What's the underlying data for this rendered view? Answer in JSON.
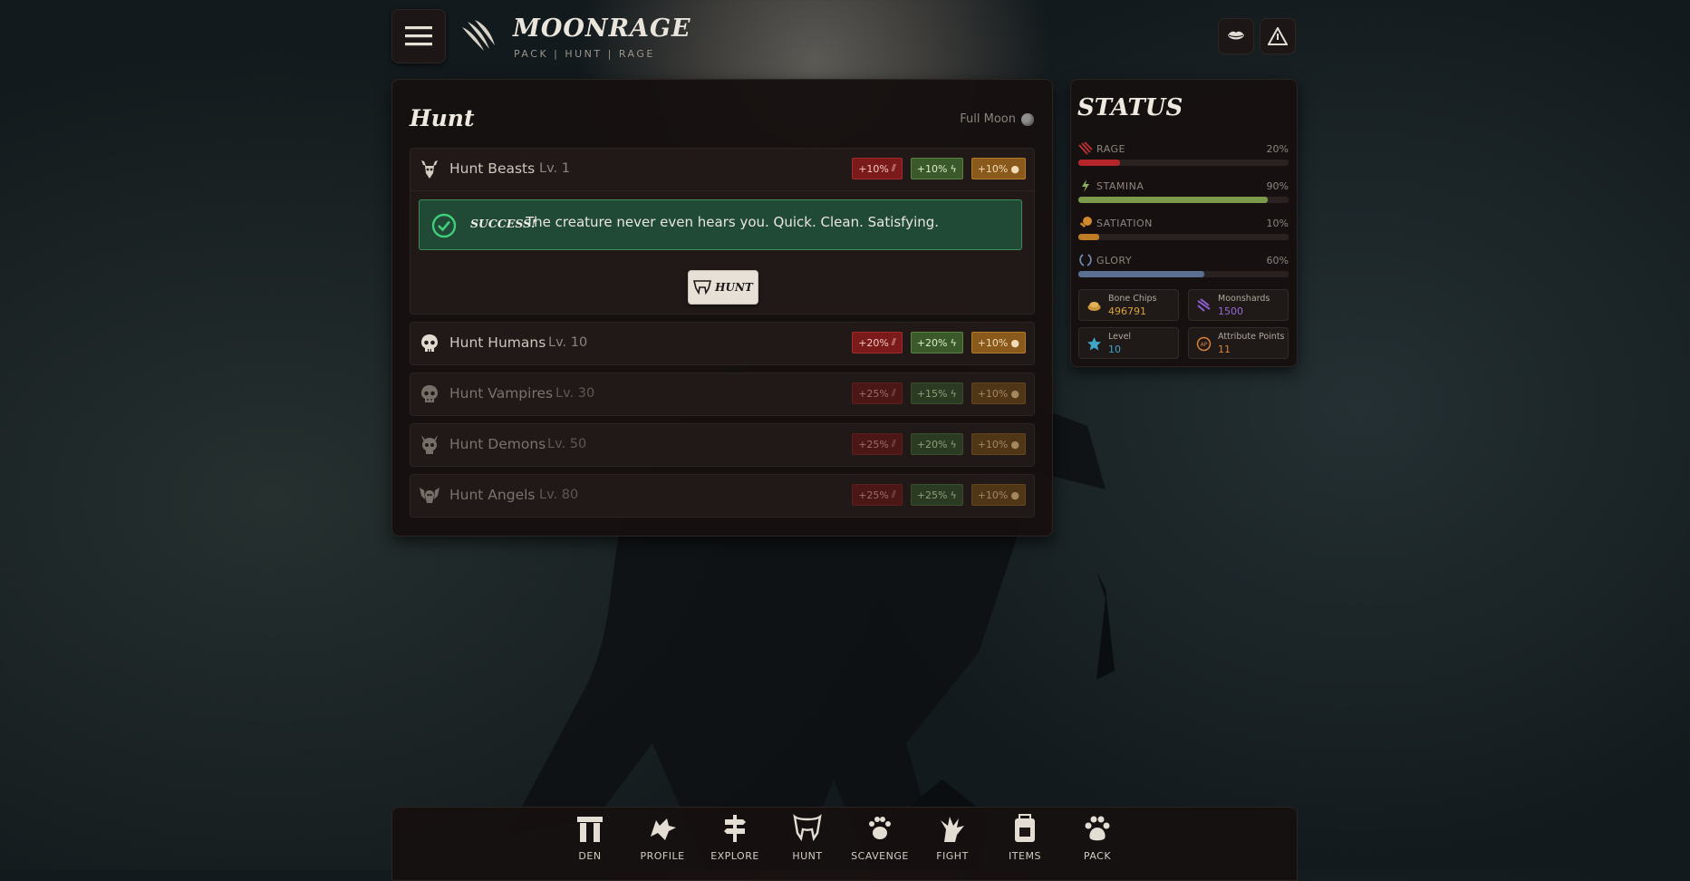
{
  "header": {
    "title": "MOONRAGE",
    "subtitle": "PACK | HUNT | RAGE"
  },
  "icons": {
    "menu": "hamburger-icon",
    "logo": "claw-marks-icon",
    "top_right": [
      "lips-icon",
      "warning-icon"
    ]
  },
  "hunt": {
    "title": "Hunt",
    "moon_phase": "Full Moon",
    "items": [
      {
        "name": "Hunt Beasts",
        "level": "Lv. 1",
        "icon": "stag-skull-icon",
        "rage": "+10%",
        "stamina": "+10%",
        "satiation": "+10%",
        "locked": false
      },
      {
        "name": "Hunt Humans",
        "level": "Lv. 10",
        "icon": "skull-icon",
        "rage": "+20%",
        "stamina": "+20%",
        "satiation": "+10%",
        "locked": false
      },
      {
        "name": "Hunt Vampires",
        "level": "Lv. 30",
        "icon": "vampire-skull-icon",
        "rage": "+25%",
        "stamina": "+15%",
        "satiation": "+10%",
        "locked": true
      },
      {
        "name": "Hunt Demons",
        "level": "Lv. 50",
        "icon": "demon-skull-icon",
        "rage": "+25%",
        "stamina": "+20%",
        "satiation": "+10%",
        "locked": true
      },
      {
        "name": "Hunt Angels",
        "level": "Lv. 80",
        "icon": "angel-wings-icon",
        "rage": "+25%",
        "stamina": "+25%",
        "satiation": "+10%",
        "locked": true
      }
    ],
    "result": {
      "title": "SUCCESS!",
      "message": "The creature never even hears you. Quick. Clean. Satisfying."
    },
    "action_label": "HUNT"
  },
  "status": {
    "title": "STATUS",
    "bars": [
      {
        "label": "RAGE",
        "value": 20,
        "display": "20%",
        "color": "#b5262a",
        "icon": "claw-slash-icon"
      },
      {
        "label": "STAMINA",
        "value": 90,
        "display": "90%",
        "color": "#7c9a4a",
        "icon": "lightning-icon"
      },
      {
        "label": "SATIATION",
        "value": 10,
        "display": "10%",
        "color": "#c07b25",
        "icon": "meat-icon"
      },
      {
        "label": "GLORY",
        "value": 60,
        "display": "60%",
        "color": "#5b6f91",
        "icon": "laurel-icon"
      }
    ],
    "resources": [
      {
        "label": "Bone Chips",
        "value": "496791",
        "color": "#d9a23c",
        "icon": "bone-chips-icon"
      },
      {
        "label": "Moonshards",
        "value": "1500",
        "color": "#9a6ad8",
        "icon": "moonshard-icon"
      },
      {
        "label": "Level",
        "value": "10",
        "color": "#3fa6c9",
        "icon": "star-icon"
      },
      {
        "label": "Attribute Points",
        "value": "11",
        "color": "#d9823c",
        "icon": "ap-icon"
      }
    ]
  },
  "nav": [
    {
      "label": "DEN",
      "icon": "dolmen-icon"
    },
    {
      "label": "PROFILE",
      "icon": "wolf-head-icon"
    },
    {
      "label": "EXPLORE",
      "icon": "signpost-icon"
    },
    {
      "label": "HUNT",
      "icon": "fangs-icon"
    },
    {
      "label": "SCAVENGE",
      "icon": "paw-scratch-icon"
    },
    {
      "label": "FIGHT",
      "icon": "claw-hand-icon"
    },
    {
      "label": "ITEMS",
      "icon": "backpack-icon"
    },
    {
      "label": "PACK",
      "icon": "paw-icon"
    }
  ]
}
